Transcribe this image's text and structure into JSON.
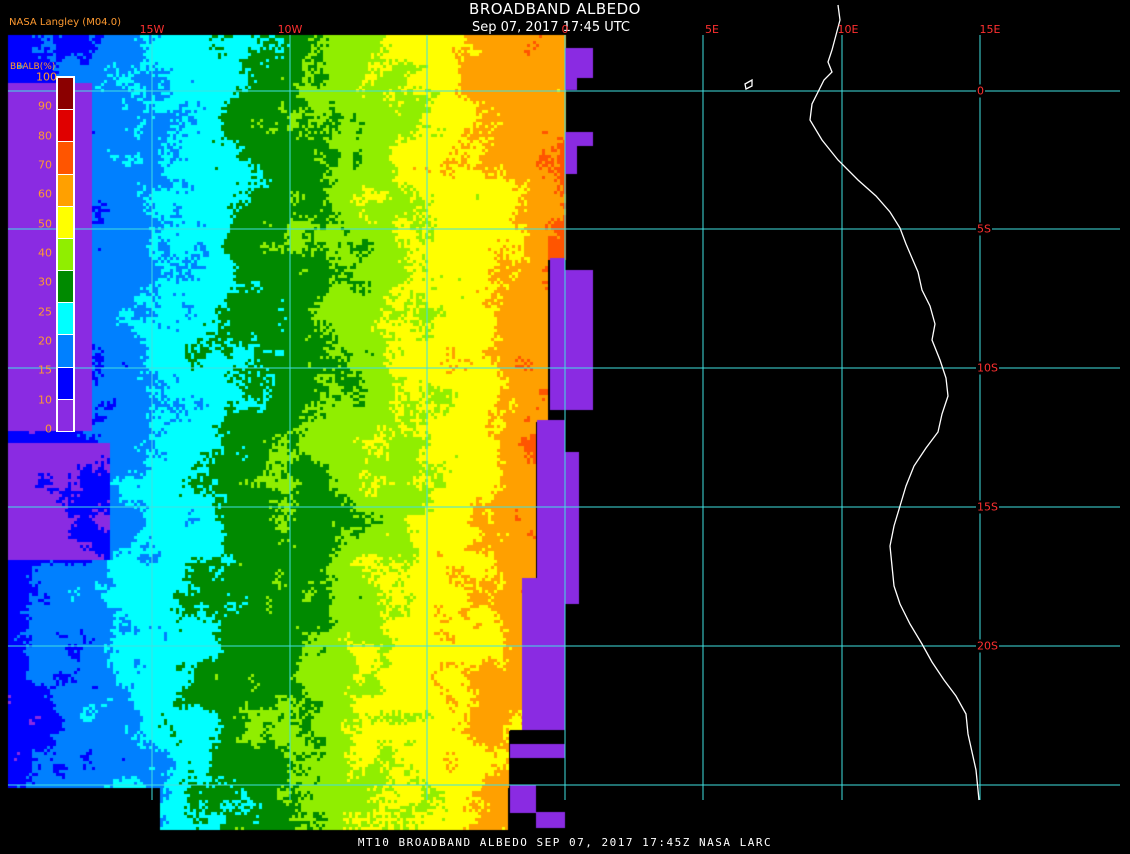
{
  "header": {
    "title": "BROADBAND ALBEDO",
    "datetime": "Sep 07, 2017 17:45 UTC",
    "credit": "NASA Langley (M04.0)"
  },
  "footer": {
    "text": "MT10  BROADBAND ALBEDO   SEP 07, 2017 17:45Z   NASA LARC"
  },
  "grid": {
    "longitude_labels": [
      "15W",
      "10W",
      "0",
      "5E",
      "10E",
      "15E"
    ],
    "latitude_labels": [
      "0",
      "5S",
      "10S",
      "15S",
      "20S"
    ],
    "grid_color": "#40e0e0",
    "label_color": "#ff3030",
    "coastline_color": "#ffffff"
  },
  "legend": {
    "title": "BBALB(%)",
    "labels": [
      "100",
      "90",
      "80",
      "70",
      "60",
      "50",
      "40",
      "30",
      "25",
      "20",
      "15",
      "10",
      "0"
    ],
    "colors": [
      "#8b0000",
      "#e00000",
      "#ff5500",
      "#ffa000",
      "#ffff00",
      "#90ee00",
      "#008a00",
      "#00ffff",
      "#0080ff",
      "#0000ff",
      "#8a2be2"
    ]
  }
}
